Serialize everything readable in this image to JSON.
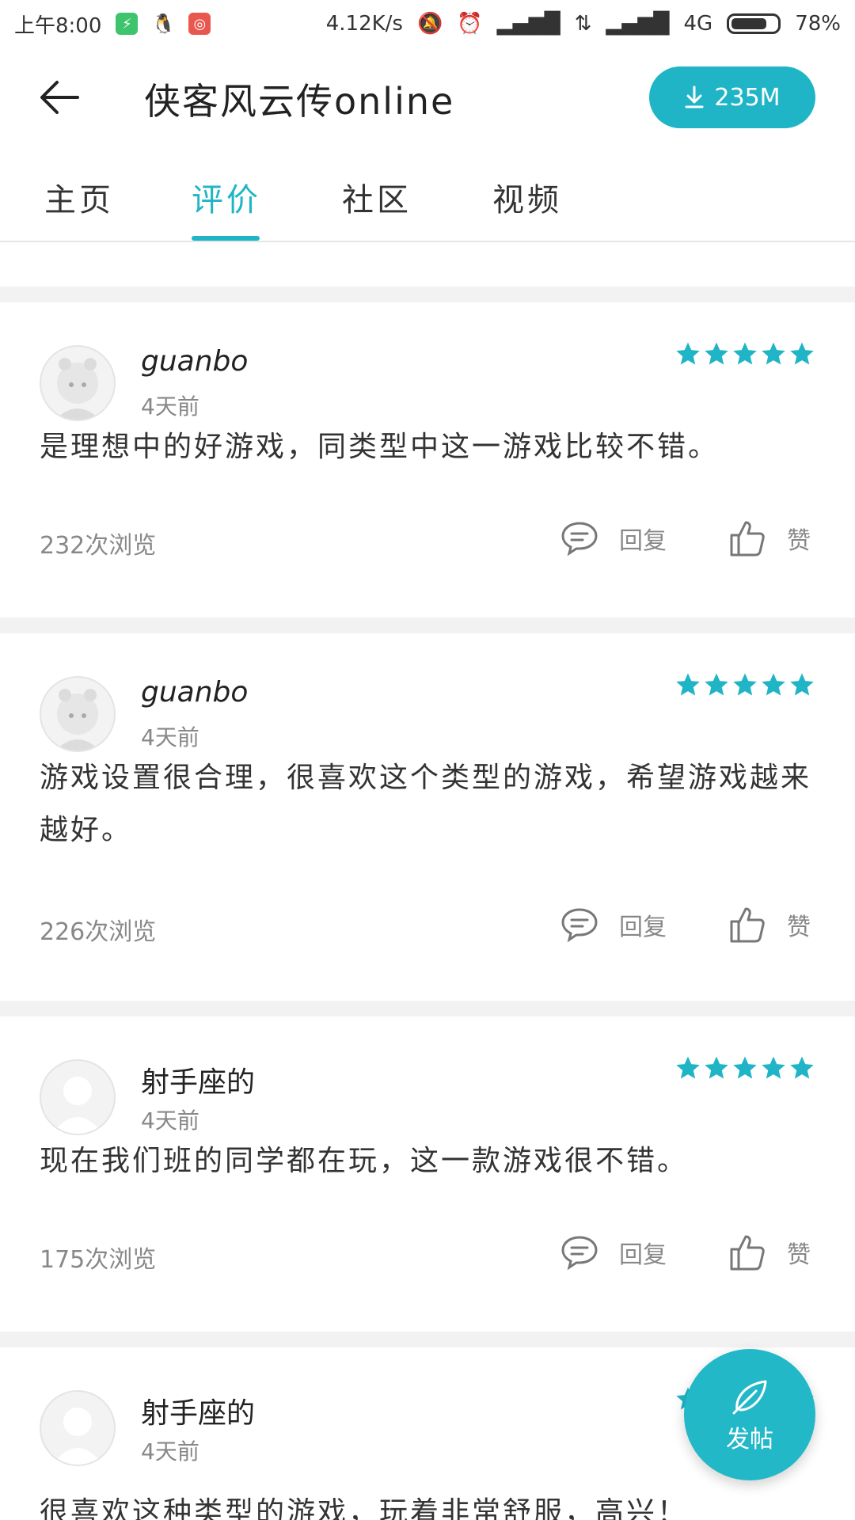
{
  "status_bar": {
    "time": "上午8:00",
    "net_speed": "4.12K/s",
    "network": "4G",
    "battery": "78%",
    "battery_level": 0.78
  },
  "header": {
    "title": "侠客风云传online",
    "download_size": "235M"
  },
  "tabs": [
    {
      "label": "主页"
    },
    {
      "label": "评价"
    },
    {
      "label": "社区"
    },
    {
      "label": "视频"
    }
  ],
  "active_tab": "评价",
  "reviews": [
    {
      "user": "guanbo",
      "time": "4天前",
      "rating": 5,
      "content": "是理想中的好游戏，同类型中这一游戏比较不错。",
      "views": "232次浏览",
      "reply_label": "回复",
      "like_label": "赞"
    },
    {
      "user": "guanbo",
      "time": "4天前",
      "rating": 5,
      "content": "游戏设置很合理，很喜欢这个类型的游戏，希望游戏越来越好。",
      "views": "226次浏览",
      "reply_label": "回复",
      "like_label": "赞"
    },
    {
      "user": "射手座的",
      "time": "4天前",
      "rating": 5,
      "content": "现在我们班的同学都在玩，这一款游戏很不错。",
      "views": "175次浏览",
      "reply_label": "回复",
      "like_label": "赞"
    },
    {
      "user": "射手座的",
      "time": "4天前",
      "rating": 5,
      "content": "很喜欢这种类型的游戏，玩着非常舒服，高兴！"
    }
  ],
  "fab": {
    "label": "发帖"
  },
  "colors": {
    "accent": "#1fb5c6",
    "star": "#1fb5c6",
    "divider": "#f2f2f2"
  }
}
